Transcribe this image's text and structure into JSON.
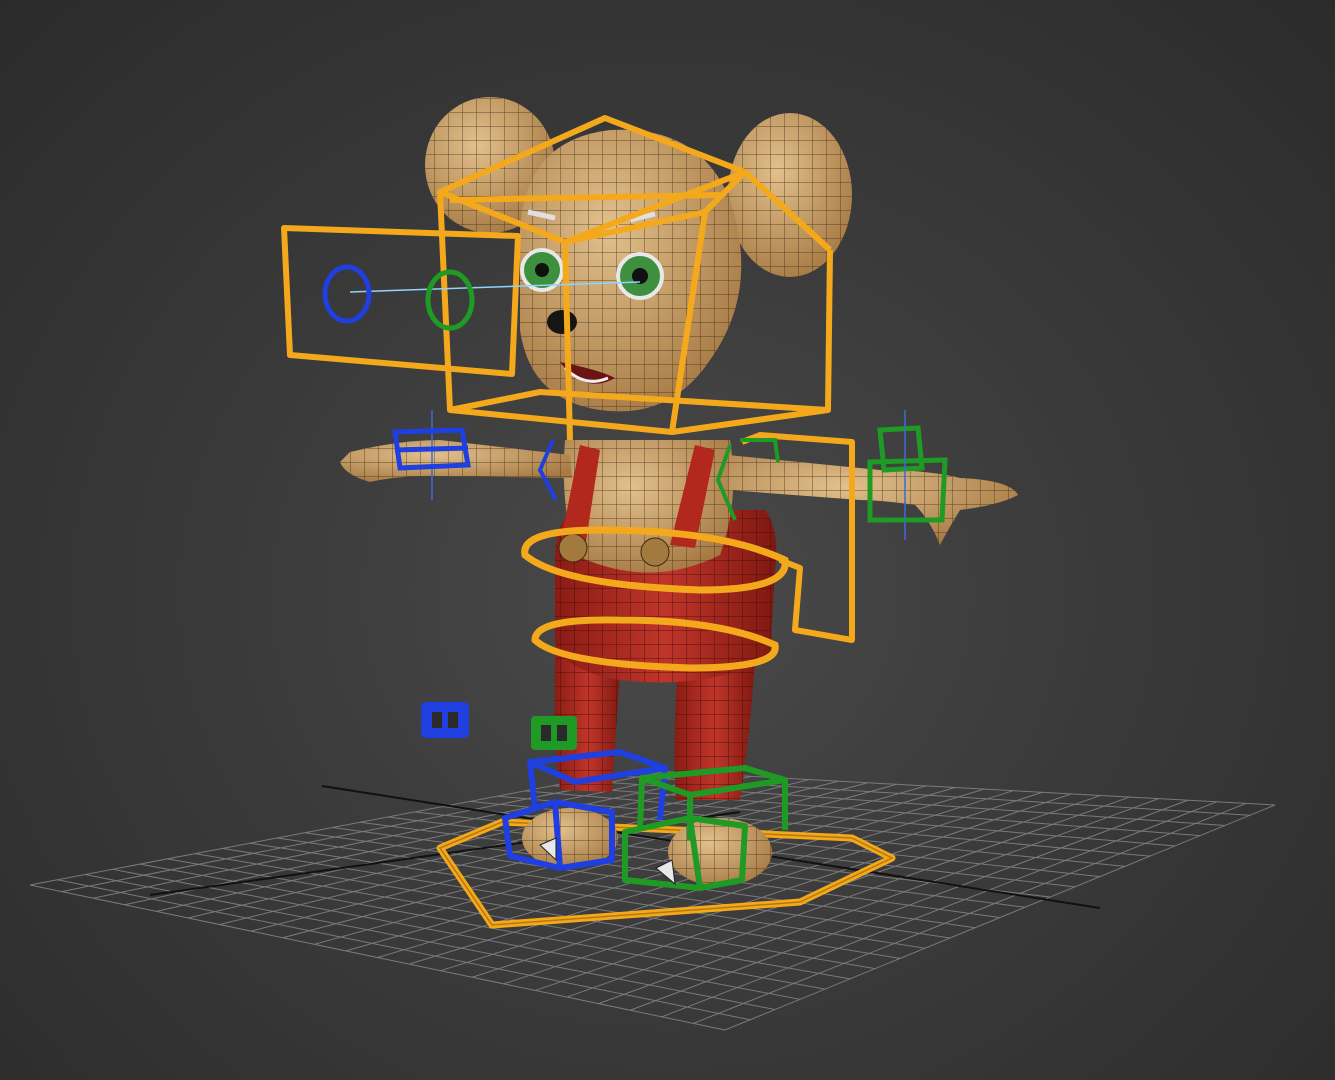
{
  "viewport": {
    "background": "#3a3a3a",
    "grid_color": "#7a7a7a",
    "axis_color": "#111111"
  },
  "character": {
    "skin_color": "#c9a06a",
    "wire_color": "#3b2a14",
    "overalls_color": "#a52a1f",
    "eye_color": "#3e8f3e"
  },
  "rig": {
    "center_color": "#f4a91c",
    "left_color": "#1f3fe0",
    "right_color": "#1f9a25"
  }
}
